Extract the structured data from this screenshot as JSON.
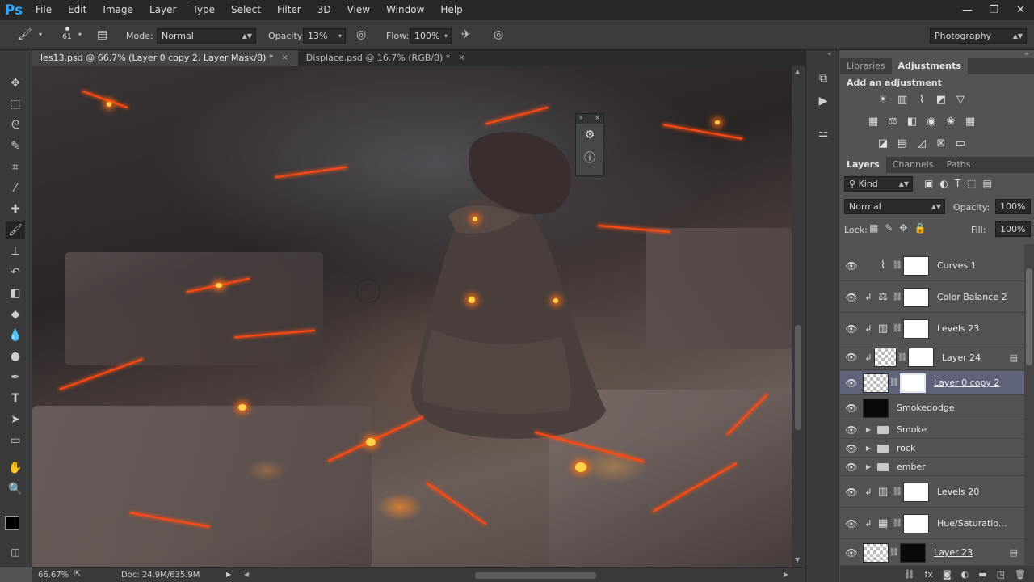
{
  "app": {
    "logo": "Ps",
    "workspace": "Photography"
  },
  "menu": [
    "File",
    "Edit",
    "Image",
    "Layer",
    "Type",
    "Select",
    "Filter",
    "3D",
    "View",
    "Window",
    "Help"
  ],
  "window_controls": {
    "minimize": "—",
    "restore": "❐",
    "close": "✕"
  },
  "options": {
    "brush_size": "61",
    "mode_label": "Mode:",
    "mode_value": "Normal",
    "opacity_label": "Opacity:",
    "opacity_value": "13%",
    "flow_label": "Flow:",
    "flow_value": "100%"
  },
  "tabs": [
    {
      "label": "les13.psd @ 66.7% (Layer 0 copy 2, Layer Mask/8) *",
      "close": "×"
    },
    {
      "label": "Displace.psd @ 16.7% (RGB/8) *",
      "close": "×"
    }
  ],
  "status": {
    "zoom": "66.67%",
    "doc": "Doc: 24.9M/635.9M"
  },
  "panels": {
    "top_tabs": [
      "Libraries",
      "Adjustments"
    ],
    "adjustments_title": "Add an adjustment",
    "layer_tabs": [
      "Layers",
      "Channels",
      "Paths"
    ],
    "filter_kind": "Kind",
    "blend_mode": "Normal",
    "opacity_label": "Opacity:",
    "opacity_value": "100%",
    "lock_label": "Lock:",
    "fill_label": "Fill:",
    "fill_value": "100%"
  },
  "layers": [
    {
      "name": "Curves 1"
    },
    {
      "name": "Color Balance 2"
    },
    {
      "name": "Levels 23"
    },
    {
      "name": "Layer 24"
    },
    {
      "name": "Layer 0 copy 2"
    },
    {
      "name": "Smokedodge"
    },
    {
      "name": "Smoke"
    },
    {
      "name": "rock"
    },
    {
      "name": "ember"
    },
    {
      "name": "Levels 20"
    },
    {
      "name": "Hue/Saturatio..."
    },
    {
      "name": "Layer 23"
    }
  ],
  "colors": {
    "accent": "#31a8ff",
    "selected_row": "#5e6379",
    "lava": "#ff4a14"
  }
}
